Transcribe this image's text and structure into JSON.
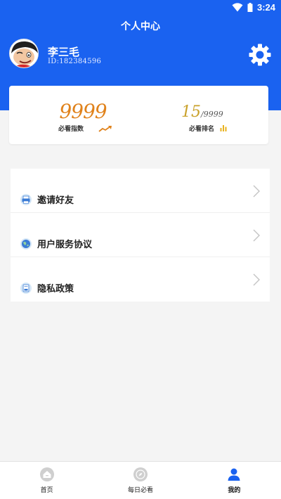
{
  "status_bar": {
    "time": "3:24"
  },
  "header": {
    "title": "个人中心"
  },
  "user": {
    "name": "李三毛",
    "id": "ID:182384596"
  },
  "stats": {
    "index_value": "9999",
    "index_label": "必看指数",
    "rank_value": "15",
    "rank_total": "/9999",
    "rank_label": "必看排名"
  },
  "menu": {
    "items": [
      {
        "label": "邀请好友",
        "icon": "printer-icon"
      },
      {
        "label": "用户服务协议",
        "icon": "globe-icon"
      },
      {
        "label": "隐私政策",
        "icon": "document-icon"
      }
    ]
  },
  "bottom_nav": {
    "items": [
      {
        "label": "首页",
        "icon": "home-icon"
      },
      {
        "label": "每日必看",
        "icon": "compass-icon"
      },
      {
        "label": "我的",
        "icon": "user-icon"
      }
    ],
    "active_index": 2
  },
  "colors": {
    "primary": "#1a62f0",
    "index_value": "#e0821b",
    "rank_value": "#c9a12a",
    "background": "#f4f4f4"
  }
}
